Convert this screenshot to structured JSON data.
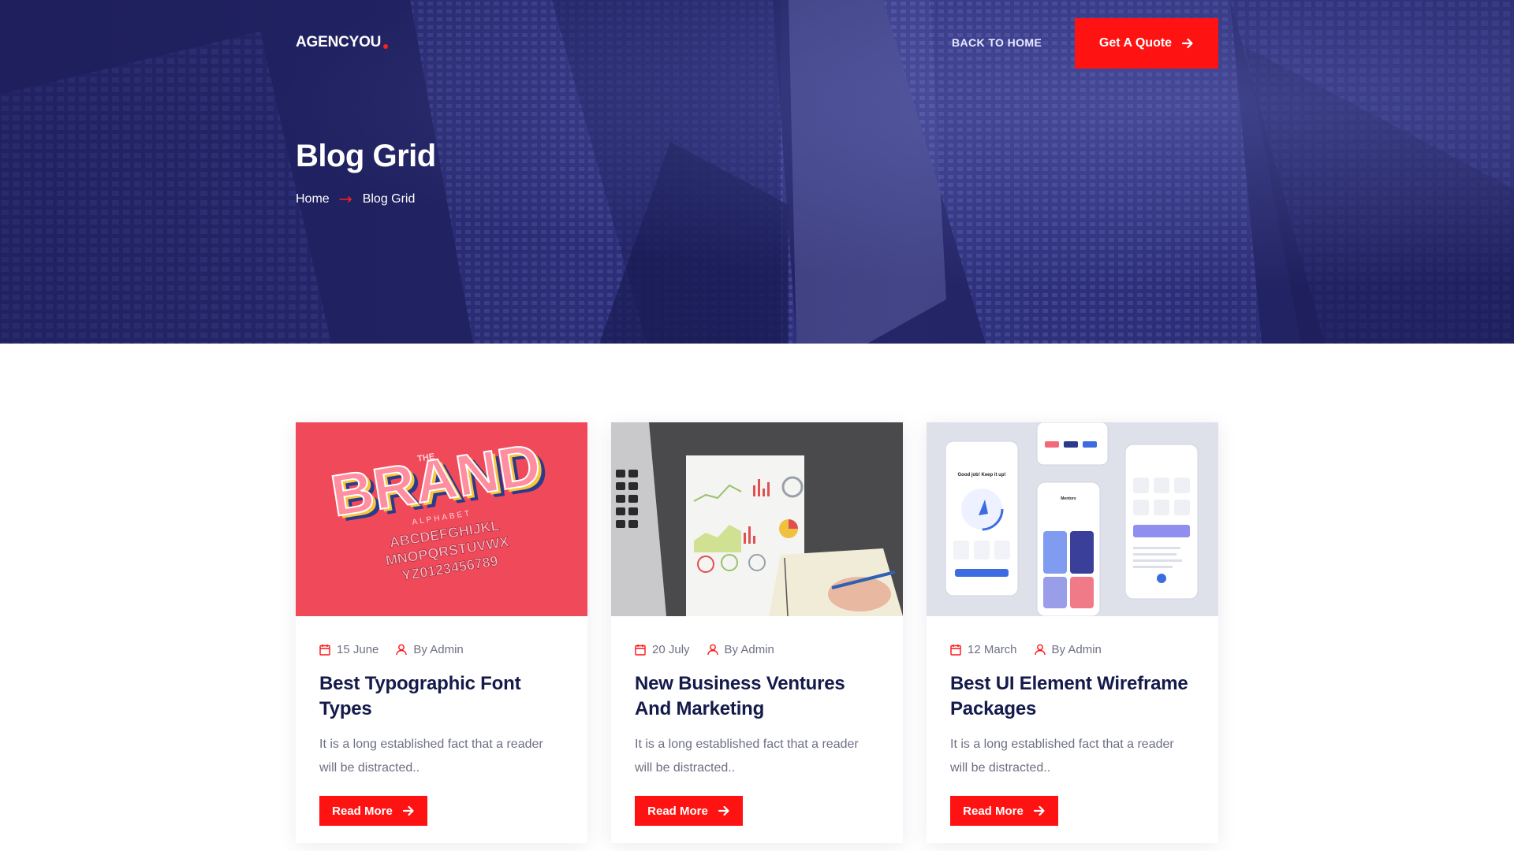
{
  "header": {
    "logo": "AGENCYOU",
    "back_home": "BACK TO HOME",
    "quote_button": "Get A Quote"
  },
  "hero": {
    "title": "Blog Grid",
    "breadcrumb": [
      "Home",
      "Blog Grid"
    ]
  },
  "posts": [
    {
      "date": "15 June",
      "author": "By Admin",
      "title": "Best Typographic Font Types",
      "excerpt": "It is a long established fact that a reader will be distracted..",
      "button": "Read More",
      "image": "brand-typography-image"
    },
    {
      "date": "20 July",
      "author": "By Admin",
      "title": "New Business Ventures And Marketing",
      "excerpt": "It is a long established fact that a reader will be distracted..",
      "button": "Read More",
      "image": "business-charts-image"
    },
    {
      "date": "12 March",
      "author": "By Admin",
      "title": "Best UI Element Wireframe Packages",
      "excerpt": "It is a long established fact that a reader will be distracted..",
      "button": "Read More",
      "image": "ui-wireframe-image"
    }
  ],
  "colors": {
    "accent": "#ff1212",
    "hero_bg": "#23255f",
    "heading": "#141a4a",
    "body_text": "#6d7083"
  }
}
